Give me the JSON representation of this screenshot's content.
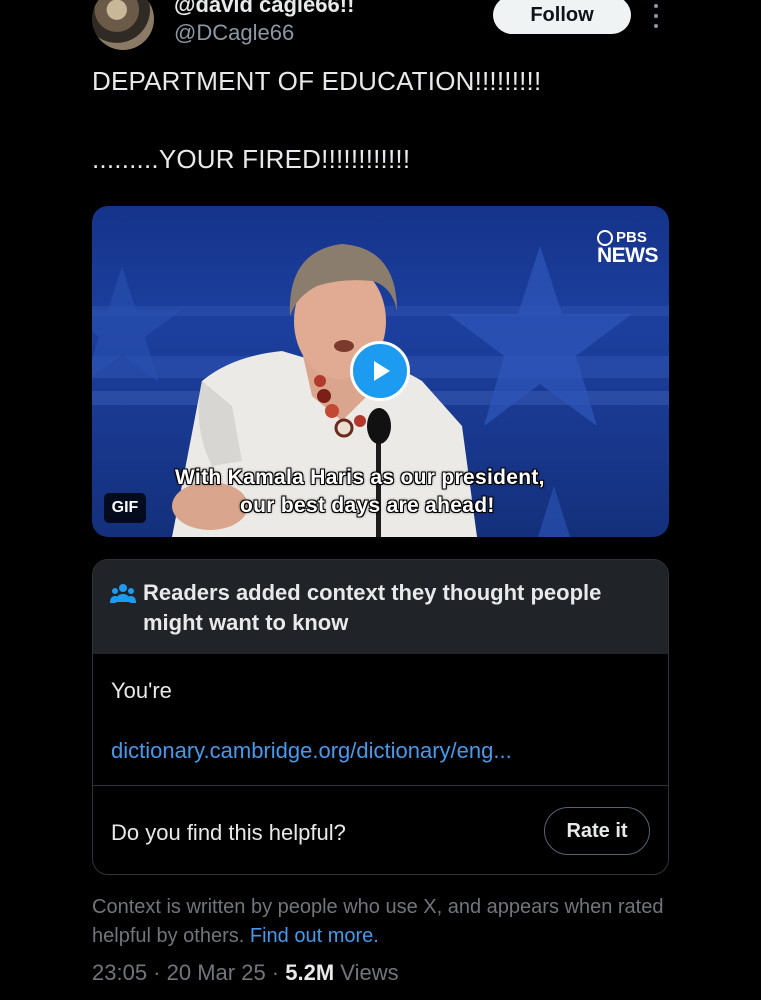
{
  "author": {
    "display_name": "@david cagle66!!",
    "handle": "@DCagle66"
  },
  "follow_label": "Follow",
  "tweet": {
    "line1": "DEPARTMENT OF EDUCATION!!!!!!!!!",
    "line2": ".........YOUR FIRED!!!!!!!!!!!!"
  },
  "media": {
    "badge": "GIF",
    "logo_top": "PBS",
    "logo_bottom": "NEWS",
    "caption_line1": "With Kamala Haris as our president,",
    "caption_line2": "our best days are ahead!"
  },
  "community_note": {
    "title": "Readers added context they thought people might want to know",
    "body": "You're",
    "link": "dictionary.cambridge.org/dictionary/eng...",
    "helpful_question": "Do you find this helpful?",
    "rate_label": "Rate it"
  },
  "footer": {
    "note": "Context is written by people who use X, and appears when rated helpful by others.",
    "find_out": "Find out more."
  },
  "meta": {
    "time": "23:05",
    "date": "20 Mar 25",
    "views_count": "5.2M",
    "views_label": "Views"
  },
  "colors": {
    "background": "#000000",
    "link": "#4a99e9",
    "play_button": "#1d9bf0",
    "note_header": "#202327"
  }
}
